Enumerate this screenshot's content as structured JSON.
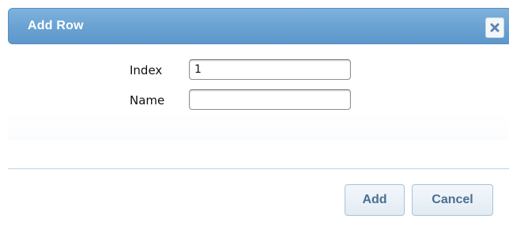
{
  "dialog": {
    "title": "Add Row",
    "close_icon": "close-icon"
  },
  "form": {
    "index_label": "Index",
    "index_value": "1",
    "name_label": "Name",
    "name_value": ""
  },
  "buttons": {
    "add_label": "Add",
    "cancel_label": "Cancel"
  },
  "colors": {
    "titlebar": "#6aa3d3",
    "button_text": "#4a6f92",
    "separator": "#b9d4ea"
  }
}
